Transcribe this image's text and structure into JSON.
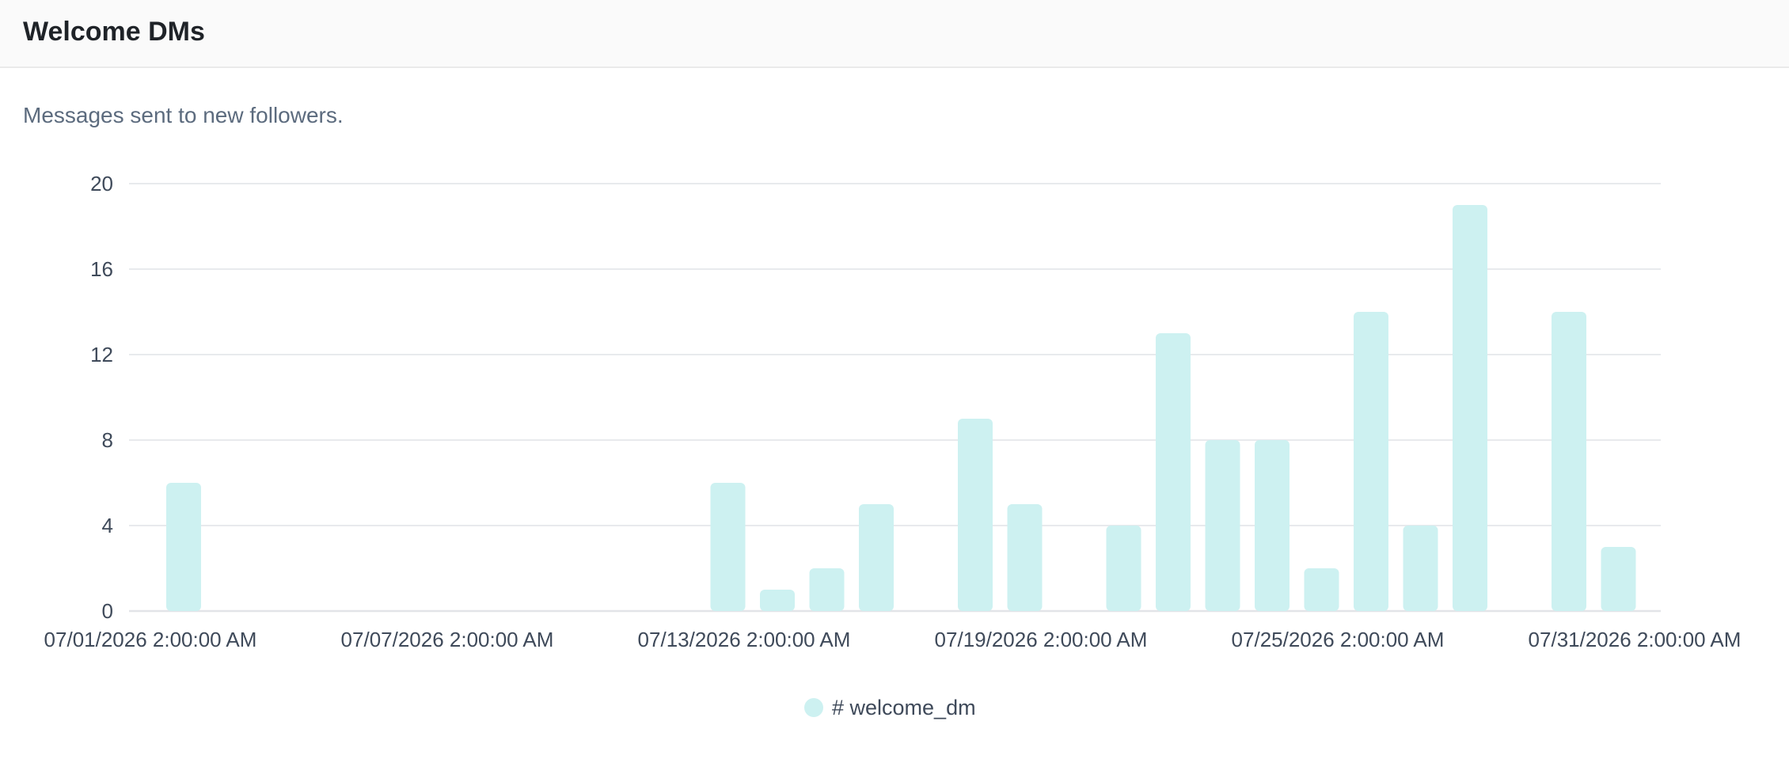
{
  "header": {
    "title": "Welcome DMs"
  },
  "description": "Messages sent to new followers.",
  "colors": {
    "bar_fill": "#cdf1f1",
    "grid": "#e8eaed",
    "axis": "#e2e4e8",
    "text": "#3f4a5a"
  },
  "chart_data": {
    "type": "bar",
    "title": "",
    "xlabel": "",
    "ylabel": "",
    "x_ticks": [
      "07/01/2026 2:00:00 AM",
      "07/07/2026 2:00:00 AM",
      "07/13/2026 2:00:00 AM",
      "07/19/2026 2:00:00 AM",
      "07/25/2026 2:00:00 AM",
      "07/31/2026 2:00:00 AM"
    ],
    "y_ticks": [
      0,
      4,
      8,
      12,
      16,
      20
    ],
    "ylim": [
      0,
      20
    ],
    "grid": true,
    "legend": "bottom-center",
    "series": [
      {
        "name": "# welcome_dm",
        "color": "#cdf1f1",
        "points": [
          {
            "x": "07/01/2026 2:00:00 AM",
            "y": 6
          },
          {
            "x": "07/12/2026 2:00:00 AM",
            "y": 6
          },
          {
            "x": "07/13/2026 2:00:00 AM",
            "y": 1
          },
          {
            "x": "07/14/2026 2:00:00 AM",
            "y": 2
          },
          {
            "x": "07/15/2026 2:00:00 AM",
            "y": 5
          },
          {
            "x": "07/17/2026 2:00:00 AM",
            "y": 9
          },
          {
            "x": "07/18/2026 2:00:00 AM",
            "y": 5
          },
          {
            "x": "07/20/2026 2:00:00 AM",
            "y": 4
          },
          {
            "x": "07/21/2026 2:00:00 AM",
            "y": 13
          },
          {
            "x": "07/22/2026 2:00:00 AM",
            "y": 8
          },
          {
            "x": "07/23/2026 2:00:00 AM",
            "y": 8
          },
          {
            "x": "07/24/2026 2:00:00 AM",
            "y": 2
          },
          {
            "x": "07/25/2026 2:00:00 AM",
            "y": 14
          },
          {
            "x": "07/26/2026 2:00:00 AM",
            "y": 4
          },
          {
            "x": "07/27/2026 2:00:00 AM",
            "y": 19
          },
          {
            "x": "07/29/2026 2:00:00 AM",
            "y": 14
          },
          {
            "x": "07/30/2026 2:00:00 AM",
            "y": 3
          }
        ]
      }
    ]
  }
}
